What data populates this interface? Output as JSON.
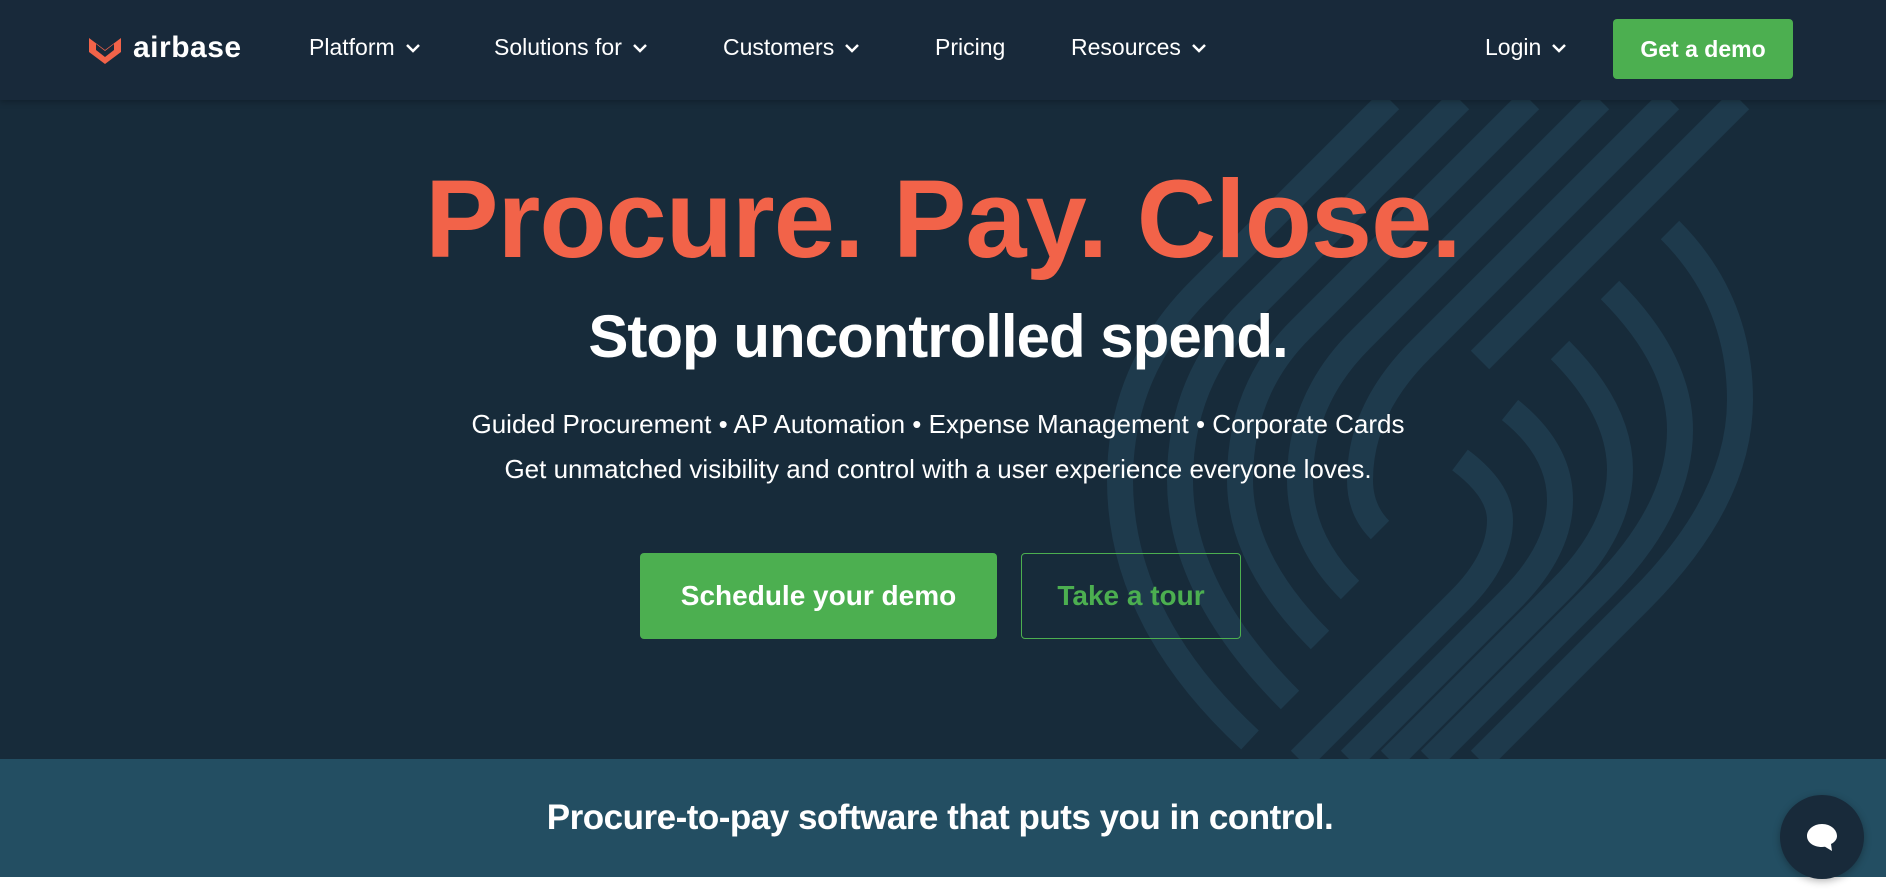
{
  "brand": {
    "name": "airbase",
    "accent": "#f26349"
  },
  "nav": {
    "items": [
      {
        "label": "Platform",
        "dropdown": true
      },
      {
        "label": "Solutions for",
        "dropdown": true
      },
      {
        "label": "Customers",
        "dropdown": true
      },
      {
        "label": "Pricing",
        "dropdown": false
      },
      {
        "label": "Resources",
        "dropdown": true
      }
    ],
    "login": "Login",
    "cta": "Get a demo"
  },
  "hero": {
    "headline": "Procure. Pay. Close.",
    "subhead": "Stop uncontrolled spend.",
    "features": "Guided Procurement • AP Automation • Expense Management • Corporate Cards",
    "tagline": "Get unmatched visibility and control with a user experience everyone loves.",
    "primary_cta": "Schedule your demo",
    "secondary_cta": "Take a tour"
  },
  "banner": {
    "text": "Procure-to-pay software that puts you in control."
  },
  "chat": {
    "icon": "chat-bubble-icon"
  },
  "colors": {
    "nav_bg": "#18293a",
    "hero_bg": "#172b3a",
    "banner_bg": "#234e62",
    "green": "#4caf50",
    "coral": "#f26349"
  }
}
